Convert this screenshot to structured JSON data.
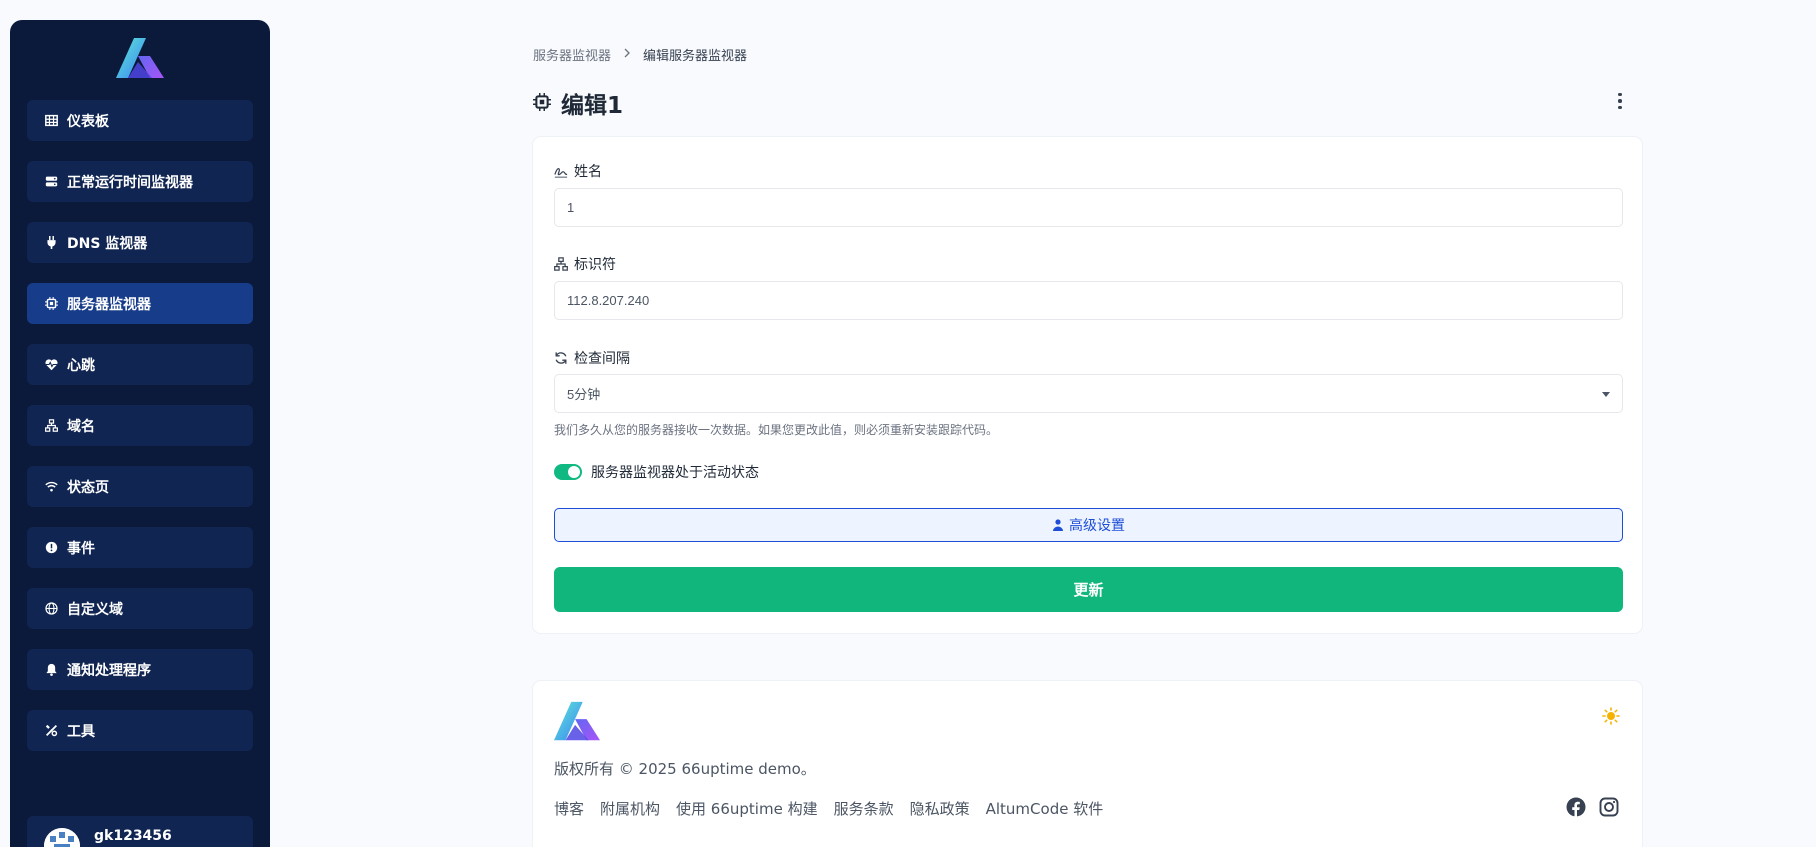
{
  "colors": {
    "sidebar_bg": "#0b1a3a",
    "nav_item_bg": "#102552",
    "nav_item_active_bg": "#173c89",
    "accent_green": "#10b67c",
    "accent_blue": "#1d4ed8",
    "sun": "#f5b301"
  },
  "sidebar": {
    "items": [
      {
        "label": "仪表板",
        "icon": "table-icon"
      },
      {
        "label": "正常运行时间监视器",
        "icon": "server-icon"
      },
      {
        "label": "DNS 监视器",
        "icon": "plug-icon"
      },
      {
        "label": "服务器监视器",
        "icon": "chip-icon",
        "active": true
      },
      {
        "label": "心跳",
        "icon": "heartbeat-icon"
      },
      {
        "label": "域名",
        "icon": "network-icon"
      },
      {
        "label": "状态页",
        "icon": "wifi-icon"
      },
      {
        "label": "事件",
        "icon": "exclamation-icon"
      },
      {
        "label": "自定义域",
        "icon": "globe-icon"
      },
      {
        "label": "通知处理程序",
        "icon": "bell-icon"
      },
      {
        "label": "工具",
        "icon": "tools-icon"
      }
    ],
    "user": {
      "name": "gk123456",
      "icon": "avatar-icon"
    }
  },
  "breadcrumb": {
    "parent": "服务器监视器",
    "separator_icon": "chevron-right-icon",
    "current": "编辑服务器监视器"
  },
  "page": {
    "title": "编辑1",
    "title_icon": "chip-icon",
    "more_icon": "more-vertical-icon"
  },
  "form": {
    "name": {
      "label": "姓名",
      "icon": "signature-icon",
      "value": "1"
    },
    "identifier": {
      "label": "标识符",
      "icon": "network-icon",
      "value": "112.8.207.240"
    },
    "interval": {
      "label": "检查间隔",
      "icon": "sync-icon",
      "value": "5分钟"
    },
    "help_text": "我们多久从您的服务器接收一次数据。如果您更改此值，则必须重新安装跟踪代码。",
    "active_toggle": {
      "label": "服务器监视器处于活动状态",
      "on": true
    },
    "advanced_button": "高级设置",
    "advanced_icon": "user-cog-icon",
    "update_button": "更新"
  },
  "footer": {
    "copyright": "版权所有 © 2025 66uptime demo。",
    "links": [
      "博客",
      "附属机构",
      "使用 66uptime 构建",
      "服务条款",
      "隐私政策",
      "AltumCode 软件"
    ],
    "theme_icon": "sun-icon",
    "social": [
      "facebook-icon",
      "instagram-icon"
    ]
  }
}
